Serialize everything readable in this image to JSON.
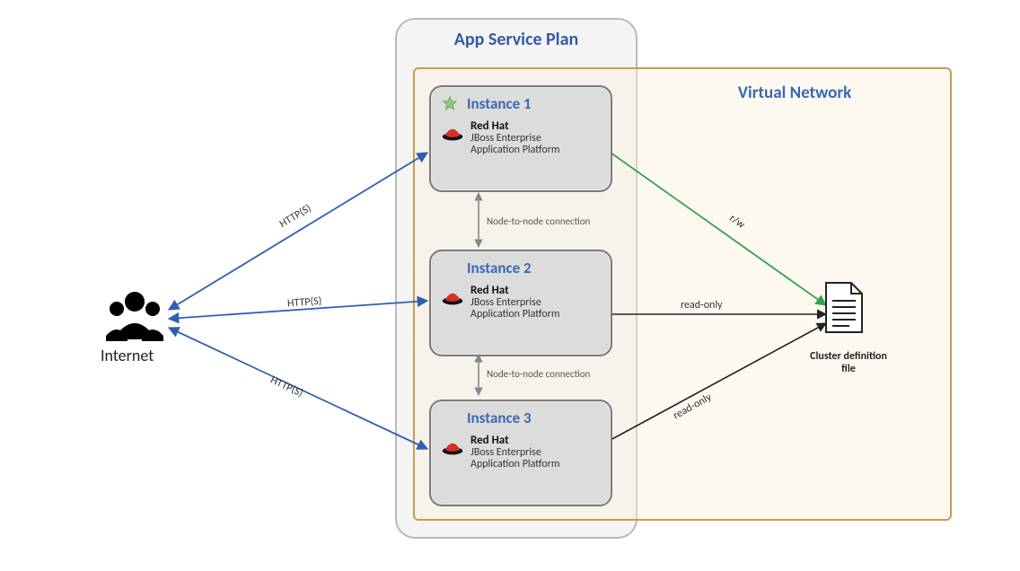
{
  "containers": {
    "app_service_plan": "App Service Plan",
    "virtual_network": "Virtual Network"
  },
  "internet": {
    "label": "Internet"
  },
  "instances": [
    {
      "title": "Instance 1",
      "vendor_name": "Red Hat",
      "vendor_line1": "JBoss Enterprise",
      "vendor_line2": "Application Platform",
      "primary": true
    },
    {
      "title": "Instance 2",
      "vendor_name": "Red Hat",
      "vendor_line1": "JBoss Enterprise",
      "vendor_line2": "Application Platform",
      "primary": false
    },
    {
      "title": "Instance 3",
      "vendor_name": "Red Hat",
      "vendor_line1": "JBoss Enterprise",
      "vendor_line2": "Application Platform",
      "primary": false
    }
  ],
  "edges": {
    "http1": "HTTP(S)",
    "http2": "HTTP(S)",
    "http3": "HTTP(S)",
    "node_conn_12": "Node-to-node connection",
    "node_conn_23": "Node-to-node connection",
    "rw": "r/w",
    "readonly2": "read-only",
    "readonly3": "read-only"
  },
  "file": {
    "label_line1": "Cluster definition",
    "label_line2": "file"
  },
  "colors": {
    "blue_edge": "#2f5fb3",
    "green_edge": "#2fa44f",
    "black_edge": "#222222",
    "container_orange": "#c79c4e",
    "title_blue": "#345aa3"
  }
}
